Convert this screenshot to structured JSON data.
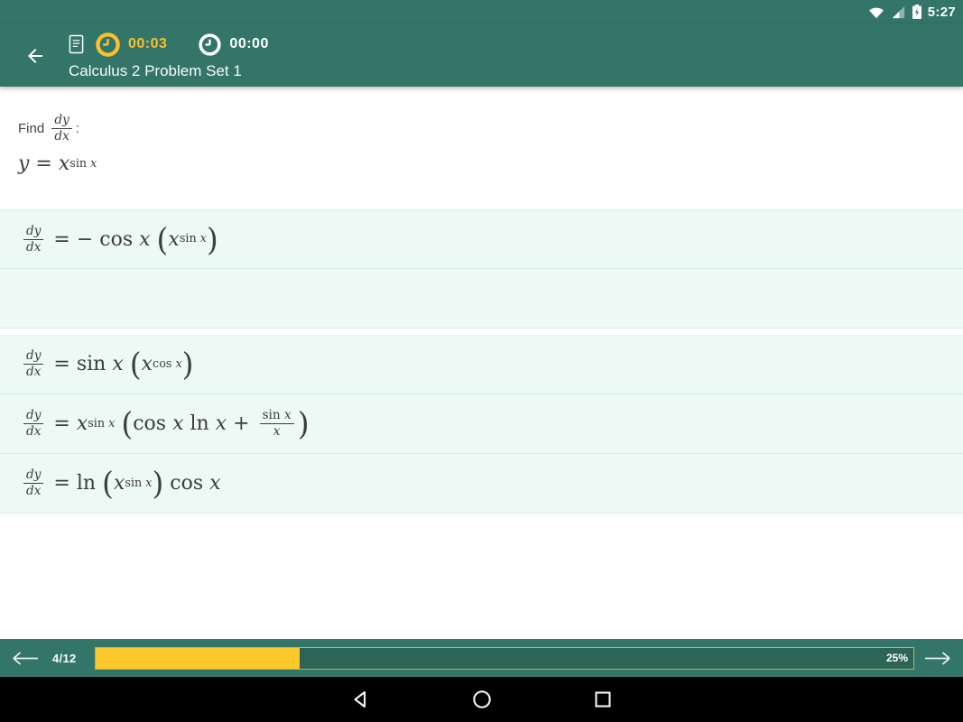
{
  "colors": {
    "primary_teal": "#337568",
    "accent_yellow": "#fbc02d",
    "progress_yellow": "#fcc92d",
    "option_bg": "#edf9f4",
    "divider": "#d6ece3",
    "track_bg": "#2c6557",
    "nav_bar_bg": "#000000",
    "math_text": "#3d3d3d"
  },
  "status_bar": {
    "time": "5:27",
    "icons": [
      "wifi-icon",
      "cell-signal-icon",
      "battery-charging-icon"
    ]
  },
  "header": {
    "title": "Calculus 2 Problem Set 1",
    "question_timer": "00:03",
    "total_timer": "00:00",
    "icons": [
      "back-arrow-icon",
      "document-icon",
      "clock-icon-yellow",
      "clock-icon-white"
    ]
  },
  "question": {
    "intro": [
      {
        "k": "sans",
        "v": "Find "
      },
      {
        "k": "frac",
        "n": [
          {
            "k": "it",
            "v": "dy"
          }
        ],
        "d": [
          {
            "k": "it",
            "v": "dx"
          }
        ]
      },
      {
        "k": "sans",
        "v": ":"
      }
    ],
    "expression": [
      {
        "k": "it",
        "v": "y"
      },
      {
        "k": "rm",
        "v": " = "
      },
      {
        "k": "it",
        "v": "x"
      },
      {
        "k": "sup",
        "t": [
          {
            "k": "rm",
            "v": "sin "
          },
          {
            "k": "it",
            "v": "x"
          }
        ]
      }
    ]
  },
  "options": [
    {
      "tokens": [
        {
          "k": "frac",
          "n": [
            {
              "k": "it",
              "v": "dy"
            }
          ],
          "d": [
            {
              "k": "it",
              "v": "dx"
            }
          ]
        },
        {
          "k": "rm",
          "v": " = − cos "
        },
        {
          "k": "it",
          "v": "x "
        },
        {
          "k": "big",
          "v": "("
        },
        {
          "k": "it",
          "v": "x"
        },
        {
          "k": "sup",
          "t": [
            {
              "k": "rm",
              "v": "sin "
            },
            {
              "k": "it",
              "v": "x"
            }
          ]
        },
        {
          "k": "big",
          "v": ")"
        }
      ],
      "gap_after": false
    },
    {
      "tokens": [],
      "gap_after": true
    },
    {
      "tokens": [
        {
          "k": "frac",
          "n": [
            {
              "k": "it",
              "v": "dy"
            }
          ],
          "d": [
            {
              "k": "it",
              "v": "dx"
            }
          ]
        },
        {
          "k": "rm",
          "v": " = sin "
        },
        {
          "k": "it",
          "v": "x "
        },
        {
          "k": "big",
          "v": "("
        },
        {
          "k": "it",
          "v": "x"
        },
        {
          "k": "sup",
          "t": [
            {
              "k": "rm",
              "v": "cos "
            },
            {
              "k": "it",
              "v": "x"
            }
          ]
        },
        {
          "k": "big",
          "v": ")"
        }
      ],
      "gap_after": false
    },
    {
      "tokens": [
        {
          "k": "frac",
          "n": [
            {
              "k": "it",
              "v": "dy"
            }
          ],
          "d": [
            {
              "k": "it",
              "v": "dx"
            }
          ]
        },
        {
          "k": "rm",
          "v": " = "
        },
        {
          "k": "it",
          "v": "x"
        },
        {
          "k": "sup",
          "t": [
            {
              "k": "rm",
              "v": "sin "
            },
            {
              "k": "it",
              "v": "x"
            }
          ]
        },
        {
          "k": "rm",
          "v": " "
        },
        {
          "k": "big",
          "v": "("
        },
        {
          "k": "rm",
          "v": "cos "
        },
        {
          "k": "it",
          "v": "x"
        },
        {
          "k": "rm",
          "v": " ln "
        },
        {
          "k": "it",
          "v": "x"
        },
        {
          "k": "rm",
          "v": " + "
        },
        {
          "k": "frac",
          "n": [
            {
              "k": "rm",
              "v": "sin "
            },
            {
              "k": "it",
              "v": "x"
            }
          ],
          "d": [
            {
              "k": "it",
              "v": "x"
            }
          ]
        },
        {
          "k": "big",
          "v": ")"
        }
      ],
      "gap_after": false
    },
    {
      "tokens": [
        {
          "k": "frac",
          "n": [
            {
              "k": "it",
              "v": "dy"
            }
          ],
          "d": [
            {
              "k": "it",
              "v": "dx"
            }
          ]
        },
        {
          "k": "rm",
          "v": " = ln "
        },
        {
          "k": "big",
          "v": "("
        },
        {
          "k": "it",
          "v": "x"
        },
        {
          "k": "sup",
          "t": [
            {
              "k": "rm",
              "v": "sin "
            },
            {
              "k": "it",
              "v": "x"
            }
          ]
        },
        {
          "k": "big",
          "v": ")"
        },
        {
          "k": "rm",
          "v": " cos "
        },
        {
          "k": "it",
          "v": "x"
        }
      ],
      "gap_after": false
    }
  ],
  "footer": {
    "position": "4/12",
    "percent": 25,
    "percent_label": "25%",
    "icons": [
      "prev-arrow-icon",
      "next-arrow-icon"
    ]
  },
  "nav_bar": {
    "icons": [
      "nav-back-icon",
      "nav-home-icon",
      "nav-recents-icon"
    ]
  }
}
